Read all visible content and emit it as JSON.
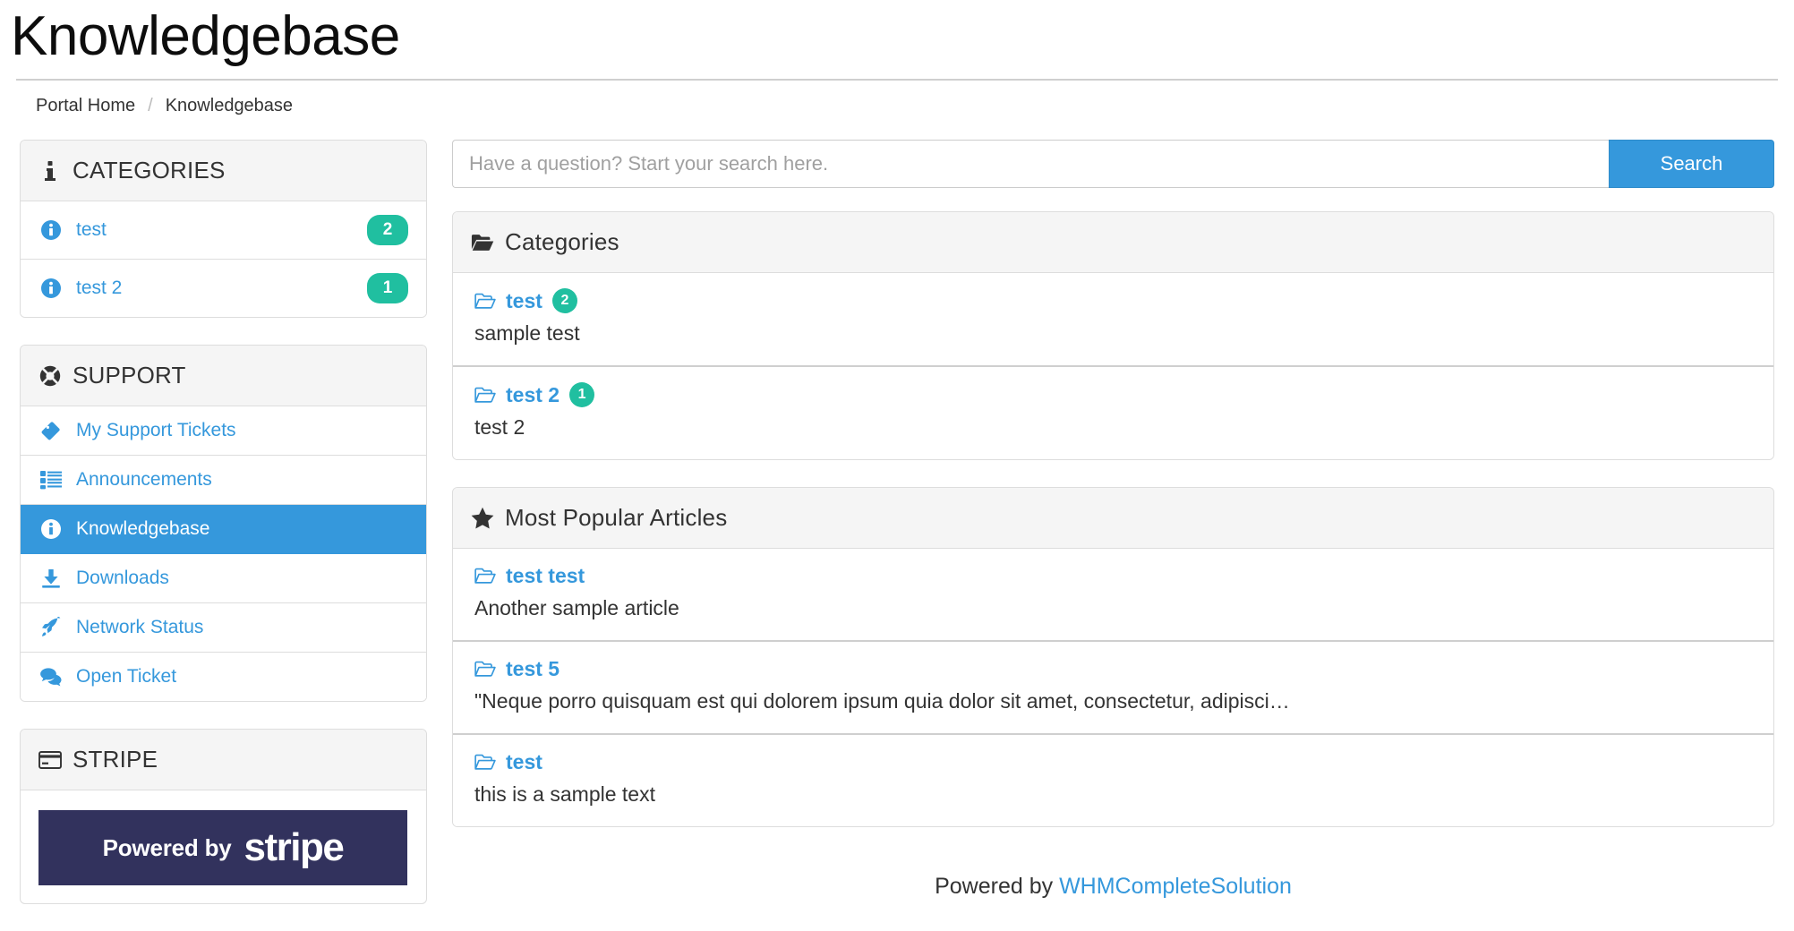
{
  "header": {
    "title": "Knowledgebase",
    "breadcrumb": [
      {
        "label": "Portal Home",
        "separator": "/"
      },
      {
        "label": "Knowledgebase",
        "separator": ""
      }
    ],
    "breadcrumb_separator": "/"
  },
  "search": {
    "placeholder": "Have a question? Start your search here.",
    "value": "",
    "button_label": "Search"
  },
  "sidebar": {
    "categories_panel": {
      "icon": "info-icon",
      "title": "CATEGORIES",
      "items": [
        {
          "label": "test",
          "badge": "2",
          "icon": "info-circle-icon"
        },
        {
          "label": "test 2",
          "badge": "1",
          "icon": "info-circle-icon"
        }
      ]
    },
    "support_panel": {
      "icon": "lifebuoy-icon",
      "title": "SUPPORT",
      "items": [
        {
          "label": "My Support Tickets",
          "icon": "ticket-icon",
          "active": false
        },
        {
          "label": "Announcements",
          "icon": "list-icon",
          "active": false
        },
        {
          "label": "Knowledgebase",
          "icon": "info-circle-icon",
          "active": true
        },
        {
          "label": "Downloads",
          "icon": "download-icon",
          "active": false
        },
        {
          "label": "Network Status",
          "icon": "rocket-icon",
          "active": false
        },
        {
          "label": "Open Ticket",
          "icon": "comments-icon",
          "active": false
        }
      ]
    },
    "stripe_panel": {
      "icon": "credit-card-icon",
      "title": "STRIPE",
      "logo_prefix": "Powered by",
      "logo_word": "stripe"
    }
  },
  "main": {
    "categories_panel": {
      "icon": "folder-open-icon",
      "title": "Categories",
      "rows": [
        {
          "title": "test",
          "badge": "2",
          "description": "sample test",
          "icon": "folder-open-icon"
        },
        {
          "title": "test 2",
          "badge": "1",
          "description": "test 2",
          "icon": "folder-open-icon"
        }
      ]
    },
    "popular_panel": {
      "icon": "star-icon",
      "title": "Most Popular Articles",
      "rows": [
        {
          "title": "test test",
          "badge": "",
          "description": "Another sample article",
          "icon": "folder-open-icon"
        },
        {
          "title": "test 5",
          "badge": "",
          "description": "\"Neque porro quisquam est qui dolorem ipsum quia dolor sit amet, consectetur, adipisci…",
          "icon": "folder-open-icon"
        },
        {
          "title": "test",
          "badge": "",
          "description": "this is a sample text",
          "icon": "folder-open-icon"
        }
      ]
    }
  },
  "footer": {
    "prefix": "Powered by ",
    "link_label": "WHMCompleteSolution"
  },
  "colors": {
    "accent_blue": "#3598dc",
    "badge_teal": "#20bfa0",
    "panel_header": "#f5f5f5",
    "border": "#dddddd",
    "stripe_navy": "#32325d",
    "text": "#333333"
  }
}
